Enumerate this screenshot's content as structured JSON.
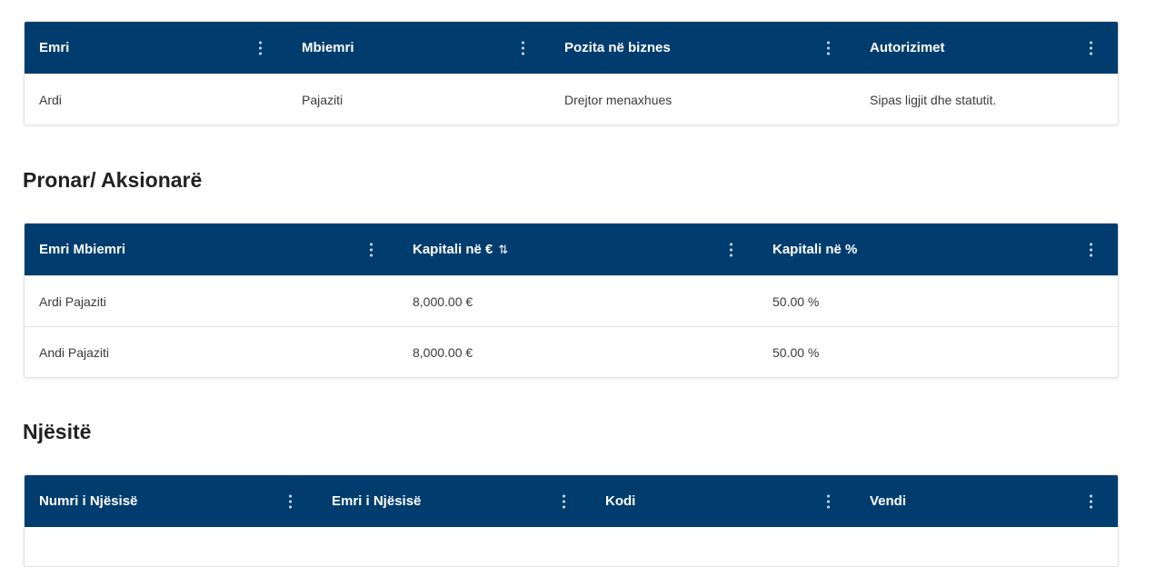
{
  "management": {
    "columns": [
      "Emri",
      "Mbiemri",
      "Pozita në biznes",
      "Autorizimet"
    ],
    "rows": [
      [
        "Ardi",
        "Pajaziti",
        "Drejtor menaxhues",
        "Sipas ligjit dhe statutit."
      ]
    ]
  },
  "owners": {
    "title": "Pronar/ Aksionarë",
    "columns": [
      "Emri Mbiemri",
      "Kapitali në €",
      "Kapitali në %"
    ],
    "sort_icon": "⇅",
    "rows": [
      [
        "Ardi Pajaziti",
        "8,000.00 €",
        "50.00 %"
      ],
      [
        "Andi Pajaziti",
        "8,000.00 €",
        "50.00 %"
      ]
    ]
  },
  "units": {
    "title": "Njësitë",
    "columns": [
      "Numri i Njësisë",
      "Emri i Njësisë",
      "Kodi",
      "Vendi"
    ],
    "rows": []
  },
  "colors": {
    "header_bg": "#003d6e",
    "header_text": "#ffffff"
  },
  "icons": {
    "column_menu": "kebab-vertical-icon",
    "sort": "sort-arrows-icon"
  }
}
